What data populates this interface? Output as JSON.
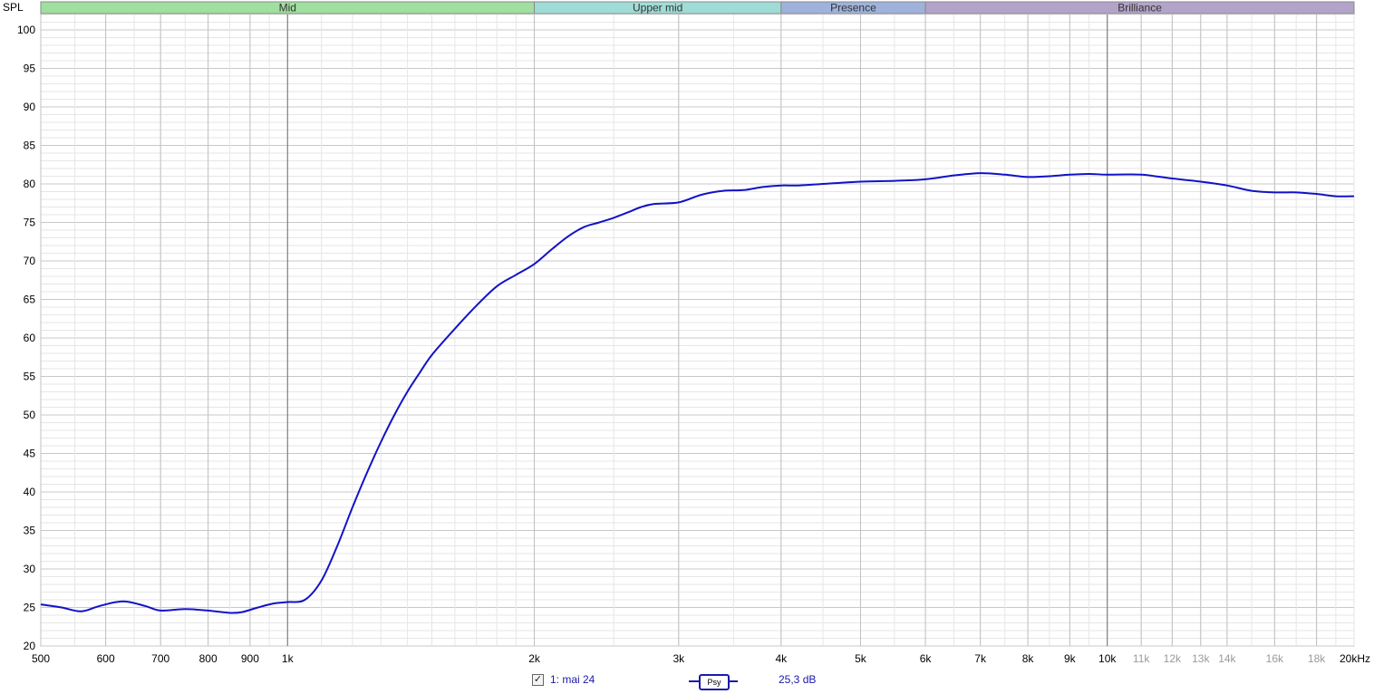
{
  "chart_data": {
    "type": "line",
    "ylabel": "SPL",
    "xunit": "kHz",
    "ylim": [
      20,
      102
    ],
    "xlim": [
      500,
      20000
    ],
    "xscale": "log",
    "grid": true,
    "yticks": [
      "20",
      "25",
      "30",
      "35",
      "40",
      "45",
      "50",
      "55",
      "60",
      "65",
      "70",
      "75",
      "80",
      "85",
      "90",
      "95",
      "100"
    ],
    "xticks_major": [
      {
        "v": 500,
        "label": "500"
      },
      {
        "v": 600,
        "label": "600"
      },
      {
        "v": 700,
        "label": "700"
      },
      {
        "v": 800,
        "label": "800"
      },
      {
        "v": 900,
        "label": "900"
      },
      {
        "v": 1000,
        "label": "1k"
      },
      {
        "v": 2000,
        "label": "2k"
      },
      {
        "v": 3000,
        "label": "3k"
      },
      {
        "v": 4000,
        "label": "4k"
      },
      {
        "v": 5000,
        "label": "5k"
      },
      {
        "v": 6000,
        "label": "6k"
      },
      {
        "v": 7000,
        "label": "7k"
      },
      {
        "v": 8000,
        "label": "8k"
      },
      {
        "v": 9000,
        "label": "9k"
      },
      {
        "v": 10000,
        "label": "10k"
      }
    ],
    "xticks_minor": [
      {
        "v": 11000,
        "label": "11k"
      },
      {
        "v": 12000,
        "label": "12k"
      },
      {
        "v": 13000,
        "label": "13k"
      },
      {
        "v": 14000,
        "label": "14k"
      },
      {
        "v": 16000,
        "label": "16k"
      },
      {
        "v": 18000,
        "label": "18k"
      }
    ],
    "xtick_end": {
      "v": 20000,
      "label": "20kHz"
    },
    "bands": [
      {
        "label": "Mid",
        "from": 500,
        "to": 2000,
        "color": "#9fdf9f"
      },
      {
        "label": "Upper mid",
        "from": 2000,
        "to": 4000,
        "color": "#9fdcd6"
      },
      {
        "label": "Presence",
        "from": 4000,
        "to": 6000,
        "color": "#9fb2dc"
      },
      {
        "label": "Brilliance",
        "from": 6000,
        "to": 20000,
        "color": "#b3a3c9"
      }
    ],
    "series": [
      {
        "name": "1: mai 24",
        "color": "#1212c8",
        "x": [
          500,
          530,
          560,
          590,
          630,
          670,
          700,
          750,
          800,
          850,
          880,
          920,
          960,
          1000,
          1050,
          1100,
          1150,
          1200,
          1250,
          1300,
          1350,
          1400,
          1450,
          1500,
          1600,
          1700,
          1800,
          1900,
          2000,
          2100,
          2200,
          2300,
          2400,
          2500,
          2600,
          2700,
          2800,
          3000,
          3200,
          3400,
          3600,
          3800,
          4000,
          4200,
          4500,
          5000,
          5500,
          6000,
          6500,
          7000,
          7500,
          8000,
          8500,
          9000,
          9500,
          10000,
          11000,
          12000,
          13000,
          14000,
          15000,
          16000,
          17000,
          18000,
          19000,
          20000
        ],
        "values": [
          25.4,
          25.0,
          24.5,
          25.2,
          25.8,
          25.2,
          24.6,
          24.8,
          24.6,
          24.3,
          24.4,
          25.0,
          25.5,
          25.7,
          26.0,
          28.5,
          33.0,
          38.0,
          42.5,
          46.5,
          50.0,
          53.0,
          55.5,
          57.8,
          61.2,
          64.2,
          66.7,
          68.2,
          69.6,
          71.5,
          73.2,
          74.4,
          75.0,
          75.6,
          76.3,
          77.0,
          77.4,
          77.6,
          78.6,
          79.1,
          79.2,
          79.6,
          79.8,
          79.8,
          80.0,
          80.3,
          80.4,
          80.6,
          81.1,
          81.4,
          81.2,
          80.9,
          81.0,
          81.2,
          81.3,
          81.2,
          81.2,
          80.7,
          80.3,
          79.8,
          79.1,
          78.9,
          78.9,
          78.7,
          78.4,
          78.4
        ]
      }
    ]
  },
  "legend": {
    "checked_mark": "✓",
    "series_label": "1: mai 24",
    "smoothing_label": "Psy",
    "offset_label": "25,3 dB"
  }
}
